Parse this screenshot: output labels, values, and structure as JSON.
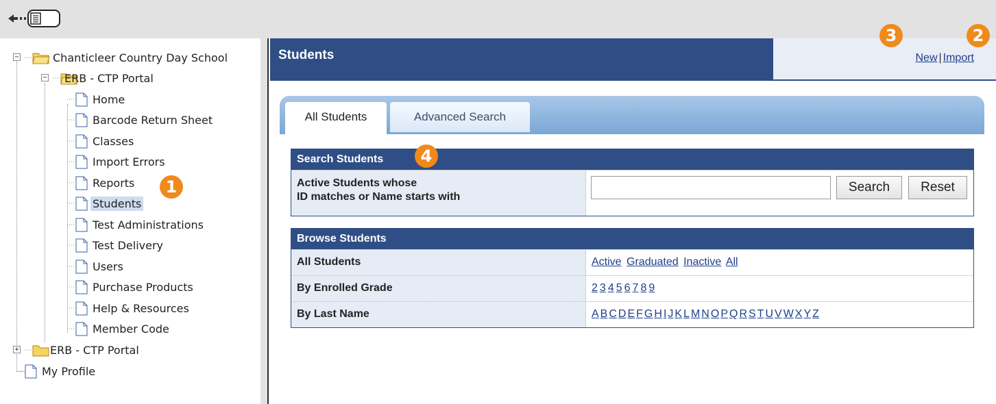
{
  "sidebar": {
    "tree": {
      "root": "Chanticleer Country Day School",
      "portal": "ERB - CTP Portal",
      "items": [
        "Home",
        "Barcode Return Sheet",
        "Classes",
        "Import Errors",
        "Reports",
        "Students",
        "Test Administrations",
        "Test Delivery",
        "Users",
        "Purchase Products",
        "Help & Resources",
        "Member Code"
      ],
      "selected": "Students",
      "portal_collapsed": "ERB - CTP Portal",
      "profile": "My Profile"
    }
  },
  "badges": {
    "b1": "1",
    "b2": "2",
    "b3": "3",
    "b4": "4",
    "color": "#f08a1c"
  },
  "header": {
    "title": "Students",
    "new_link": "New",
    "separator": "|",
    "import_link": "Import"
  },
  "tabs": {
    "all_students": "All Students",
    "advanced_search": "Advanced Search"
  },
  "search_panel": {
    "title": "Search Students",
    "label_line1": "Active Students whose",
    "label_line2": "ID matches or Name starts with",
    "input_value": "",
    "search_button": "Search",
    "reset_button": "Reset"
  },
  "browse_panel": {
    "title": "Browse Students",
    "rows": [
      {
        "label": "All Students",
        "links": [
          "Active",
          "Graduated",
          "Inactive",
          "All"
        ]
      },
      {
        "label": "By Enrolled Grade",
        "links": [
          "2",
          "3",
          "4",
          "5",
          "6",
          "7",
          "8",
          "9"
        ]
      },
      {
        "label": "By Last Name",
        "links": [
          "A",
          "B",
          "C",
          "D",
          "E",
          "F",
          "G",
          "H",
          "I",
          "J",
          "K",
          "L",
          "M",
          "N",
          "O",
          "P",
          "Q",
          "R",
          "S",
          "T",
          "U",
          "V",
          "W",
          "X",
          "Y",
          "Z"
        ]
      }
    ]
  },
  "colors": {
    "header_blue": "#2f4e85",
    "link_blue": "#1f3f8a",
    "label_bg": "#e6ecf6"
  }
}
